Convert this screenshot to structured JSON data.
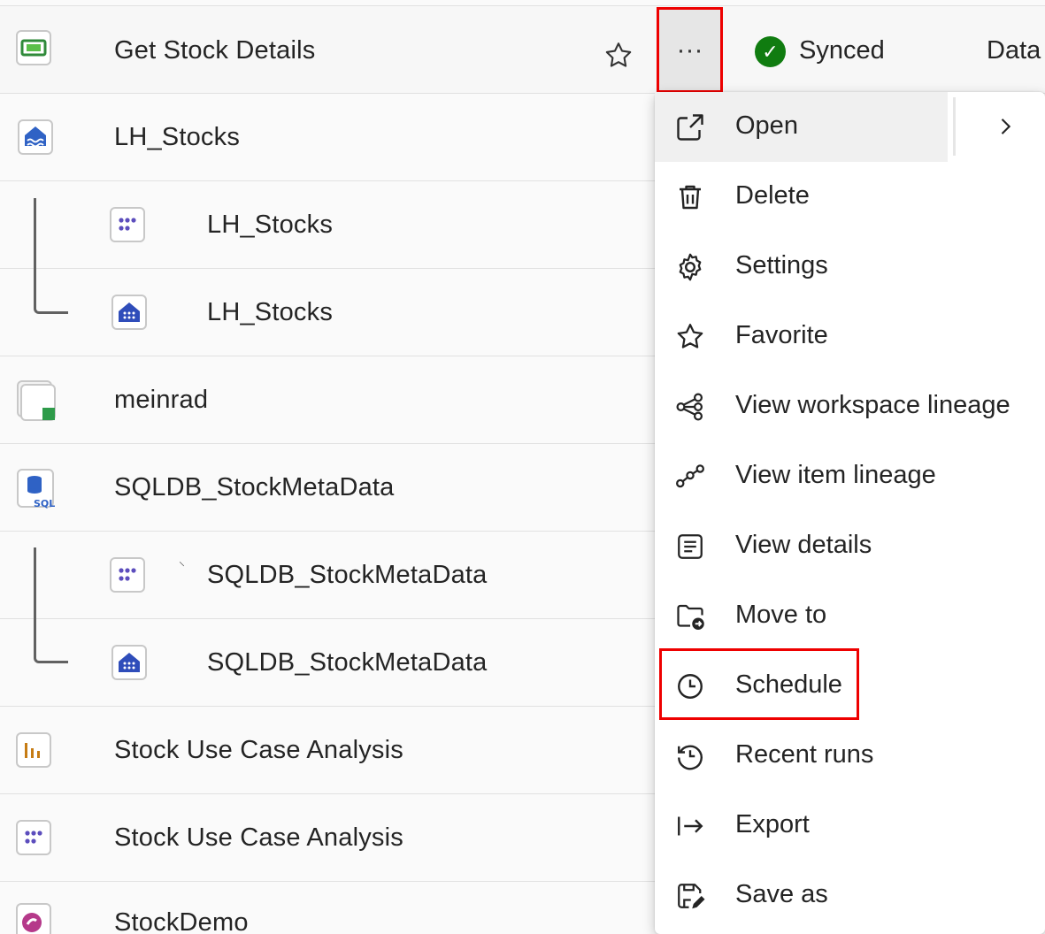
{
  "rows": [
    {
      "name": "Get Stock Details",
      "icon": "pipeline-icon"
    },
    {
      "name": "LH_Stocks",
      "icon": "lakehouse-icon"
    },
    {
      "name": "LH_Stocks",
      "icon": "semantic-model-icon"
    },
    {
      "name": "LH_Stocks",
      "icon": "sql-endpoint-icon"
    },
    {
      "name": "meinrad",
      "icon": "mirrored-item-icon"
    },
    {
      "name": "SQLDB_StockMetaData",
      "icon": "sql-database-icon"
    },
    {
      "name": "SQLDB_StockMetaData",
      "icon": "semantic-model-icon"
    },
    {
      "name": "SQLDB_StockMetaData",
      "icon": "sql-endpoint-icon"
    },
    {
      "name": "Stock Use Case Analysis",
      "icon": "report-icon"
    },
    {
      "name": "Stock Use Case Analysis",
      "icon": "semantic-model-icon"
    },
    {
      "name": "StockDemo",
      "icon": "eventstream-icon"
    }
  ],
  "first_row": {
    "more_label": "···",
    "status": "Synced",
    "next_column": "Data"
  },
  "menu": {
    "items": [
      {
        "label": "Open",
        "icon": "open-external-icon"
      },
      {
        "label": "Delete",
        "icon": "trash-icon"
      },
      {
        "label": "Settings",
        "icon": "gear-icon"
      },
      {
        "label": "Favorite",
        "icon": "star-icon"
      },
      {
        "label": "View workspace lineage",
        "icon": "workspace-lineage-icon"
      },
      {
        "label": "View item lineage",
        "icon": "item-lineage-icon"
      },
      {
        "label": "View details",
        "icon": "details-icon"
      },
      {
        "label": "Move to",
        "icon": "move-folder-icon"
      },
      {
        "label": "Schedule",
        "icon": "clock-icon"
      },
      {
        "label": "Recent runs",
        "icon": "history-icon"
      },
      {
        "label": "Export",
        "icon": "export-icon"
      },
      {
        "label": "Save as",
        "icon": "save-as-icon"
      }
    ]
  },
  "colors": {
    "highlight": "#e00000",
    "synced": "#107c10",
    "semantic_model": "#5c4dbd",
    "sql_endpoint": "#2f4dba"
  }
}
